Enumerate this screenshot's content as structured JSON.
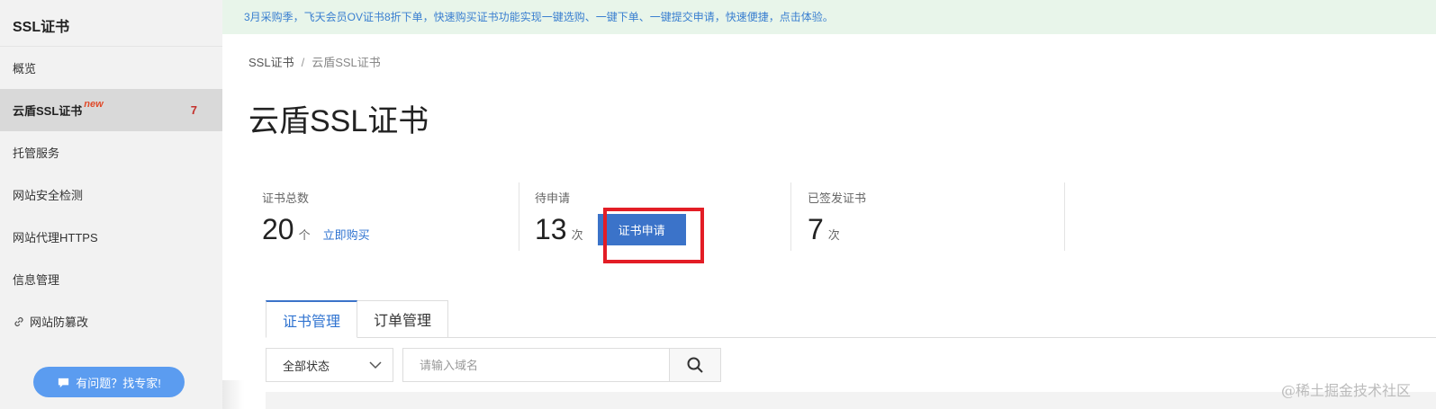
{
  "sidebar": {
    "title": "SSL证书",
    "items": [
      {
        "label": "概览"
      },
      {
        "label": "云盾SSL证书",
        "badge": "new",
        "count": "7"
      },
      {
        "label": "托管服务"
      },
      {
        "label": "网站安全检测"
      },
      {
        "label": "网站代理HTTPS"
      },
      {
        "label": "信息管理"
      },
      {
        "label": "网站防篡改",
        "icon": "link-icon"
      }
    ],
    "help_button": "有问题？找专家!"
  },
  "banner": {
    "text": "3月采购季，飞天会员OV证书8折下单，快速购买证书功能实现一键选购、一键下单、一键提交申请，快速便捷，点击体验。"
  },
  "breadcrumb": {
    "root": "SSL证书",
    "separator": "/",
    "current": "云盾SSL证书"
  },
  "page_title": "云盾SSL证书",
  "stats": {
    "total": {
      "label": "证书总数",
      "value": "20",
      "unit": "个",
      "link": "立即购买"
    },
    "pending": {
      "label": "待申请",
      "value": "13",
      "unit": "次",
      "button": "证书申请"
    },
    "issued": {
      "label": "已签发证书",
      "value": "7",
      "unit": "次"
    }
  },
  "tabs": [
    {
      "label": "证书管理",
      "active": true
    },
    {
      "label": "订单管理",
      "active": false
    }
  ],
  "filter": {
    "status_selected": "全部状态",
    "search_placeholder": "请输入域名"
  },
  "watermark": "@稀土掘金技术社区",
  "colors": {
    "accent": "#3b73c9",
    "highlight": "#e31d25",
    "banner_bg": "#e8f5ea",
    "count_red": "#c4302b"
  }
}
